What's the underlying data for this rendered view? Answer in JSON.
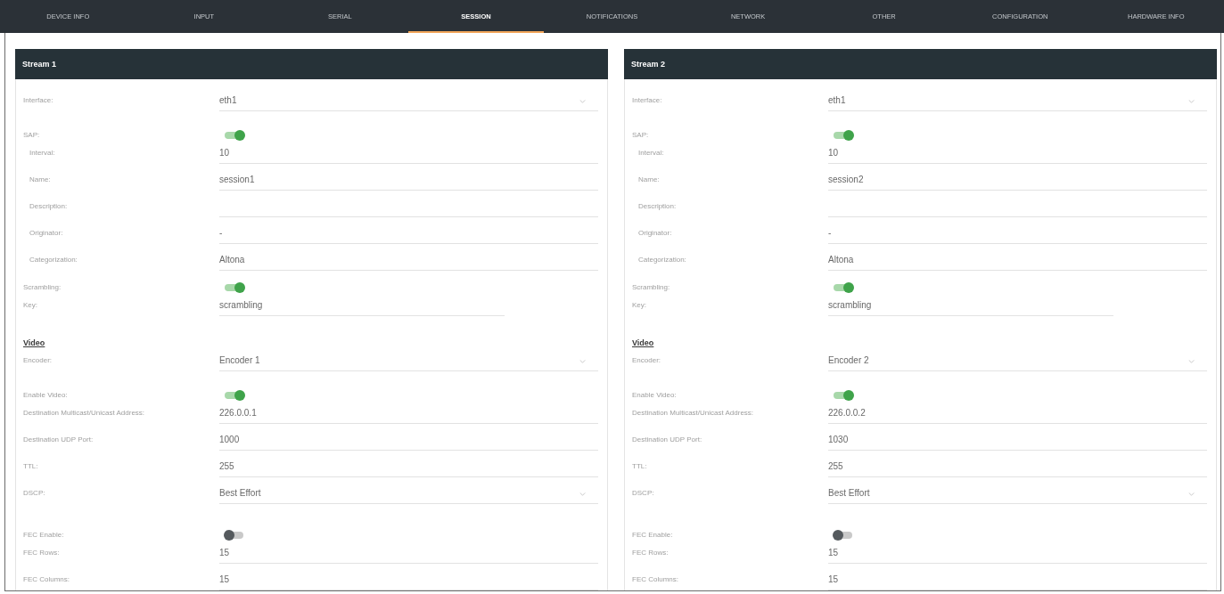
{
  "tabs": [
    {
      "label": "DEVICE INFO",
      "selected": false
    },
    {
      "label": "INPUT",
      "selected": false
    },
    {
      "label": "SERIAL",
      "selected": false
    },
    {
      "label": "SESSION",
      "selected": true
    },
    {
      "label": "NOTIFICATIONS",
      "selected": false
    },
    {
      "label": "NETWORK",
      "selected": false
    },
    {
      "label": "OTHER",
      "selected": false
    },
    {
      "label": "CONFIGURATION",
      "selected": false
    },
    {
      "label": "HARDWARE INFO",
      "selected": false
    }
  ],
  "streams": [
    {
      "title": "Stream 1",
      "sections": [
        {
          "fields": [
            {
              "label": "Interface:",
              "kind": "select",
              "value": "eth1"
            },
            {
              "label": "SAP:",
              "kind": "toggle",
              "on": true,
              "children": [
                {
                  "label": "Interval:",
                  "kind": "text",
                  "value": "10"
                },
                {
                  "label": "Name:",
                  "kind": "text",
                  "value": "session1"
                },
                {
                  "label": "Description:",
                  "kind": "text"
                },
                {
                  "label": "Originator:",
                  "kind": "text",
                  "value": "-"
                },
                {
                  "label": "Categorization:",
                  "kind": "text",
                  "value": "Altona"
                }
              ]
            },
            {
              "label": "Scrambling:",
              "kind": "toggle",
              "on": true
            },
            {
              "label": "Key:",
              "kind": "short_text",
              "value": "scrambling"
            }
          ]
        },
        {
          "heading": "Video",
          "fields": [
            {
              "label": "Encoder:",
              "kind": "select",
              "value": "Encoder 1"
            },
            {
              "label": "Enable Video:",
              "kind": "toggle",
              "on": true
            },
            {
              "label": "Destination Multicast/Unicast Address:",
              "kind": "text",
              "value": "226.0.0.1"
            },
            {
              "label": "Destination UDP Port:",
              "kind": "text",
              "value": "1000"
            },
            {
              "label": "TTL:",
              "kind": "text",
              "value": "255"
            },
            {
              "label": "DSCP:",
              "kind": "select",
              "value": "Best Effort"
            }
          ]
        },
        {
          "fields": [
            {
              "label": "FEC Enable:",
              "kind": "toggle",
              "on": false
            },
            {
              "label": "FEC Rows:",
              "kind": "text",
              "value": "15"
            },
            {
              "label": "FEC Columns:",
              "kind": "text",
              "value": "15"
            }
          ]
        }
      ]
    },
    {
      "title": "Stream 2",
      "sections": [
        {
          "fields": [
            {
              "label": "Interface:",
              "kind": "select",
              "value": "eth1"
            },
            {
              "label": "SAP:",
              "kind": "toggle",
              "on": true,
              "children": [
                {
                  "label": "Interval:",
                  "kind": "text",
                  "value": "10"
                },
                {
                  "label": "Name:",
                  "kind": "text",
                  "value": "session2"
                },
                {
                  "label": "Description:",
                  "kind": "text"
                },
                {
                  "label": "Originator:",
                  "kind": "text",
                  "value": "-"
                },
                {
                  "label": "Categorization:",
                  "kind": "text",
                  "value": "Altona"
                }
              ]
            },
            {
              "label": "Scrambling:",
              "kind": "toggle",
              "on": true
            },
            {
              "label": "Key:",
              "kind": "short_text",
              "value": "scrambling"
            }
          ]
        },
        {
          "heading": "Video",
          "fields": [
            {
              "label": "Encoder:",
              "kind": "select",
              "value": "Encoder 2"
            },
            {
              "label": "Enable Video:",
              "kind": "toggle",
              "on": true
            },
            {
              "label": "Destination Multicast/Unicast Address:",
              "kind": "text",
              "value": "226.0.0.2"
            },
            {
              "label": "Destination UDP Port:",
              "kind": "text",
              "value": "1030"
            },
            {
              "label": "TTL:",
              "kind": "text",
              "value": "255"
            },
            {
              "label": "DSCP:",
              "kind": "select",
              "value": "Best Effort"
            }
          ]
        },
        {
          "fields": [
            {
              "label": "FEC Enable:",
              "kind": "toggle",
              "on": false
            },
            {
              "label": "FEC Rows:",
              "kind": "text",
              "value": "15"
            },
            {
              "label": "FEC Columns:",
              "kind": "text",
              "value": "15"
            }
          ]
        }
      ]
    }
  ]
}
